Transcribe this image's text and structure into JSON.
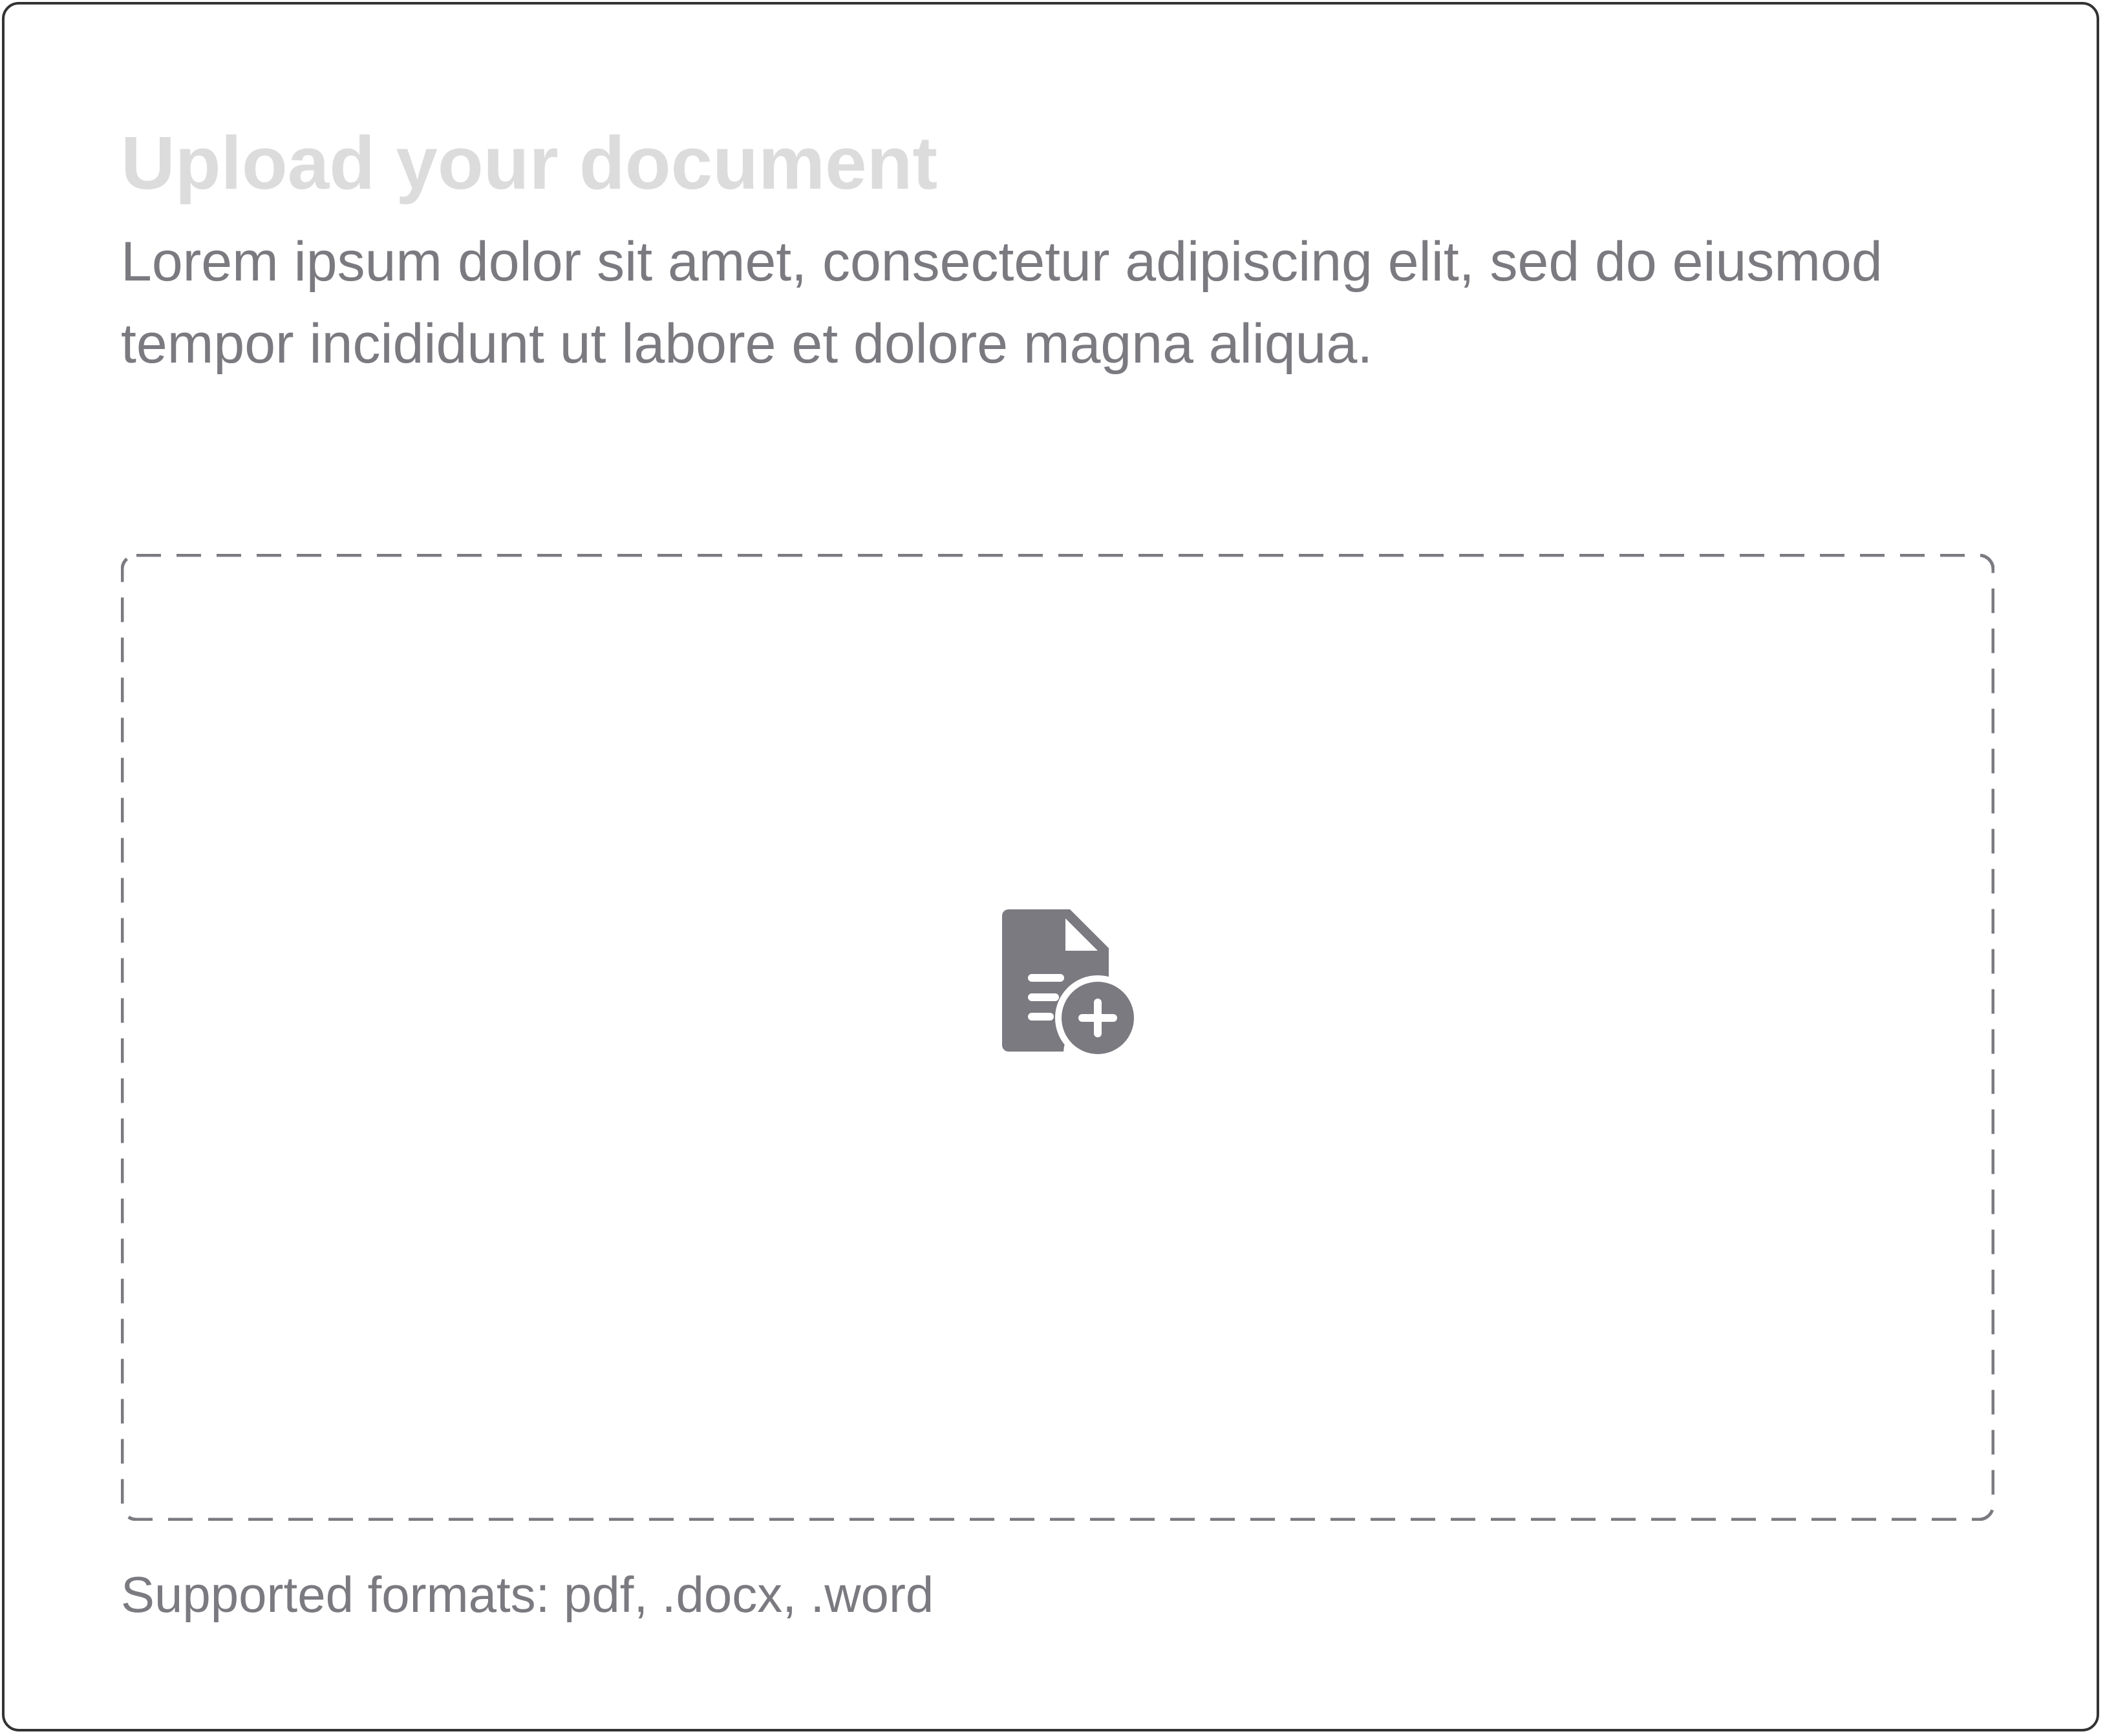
{
  "upload": {
    "title": "Upload your document",
    "description": "Lorem ipsum dolor sit amet, consectetur adipiscing elit, sed do eiusmod tempor incididunt ut labore et dolore magna aliqua.",
    "dropzone_icon": "file-add-icon",
    "supported_formats": "Supported formats: pdf, .docx, .word"
  },
  "colors": {
    "title": "#dcdcdc",
    "text": "#7a7a80",
    "icon": "#7a7a80",
    "card_border": "#333333",
    "dropzone_border": "#7a7a80"
  }
}
